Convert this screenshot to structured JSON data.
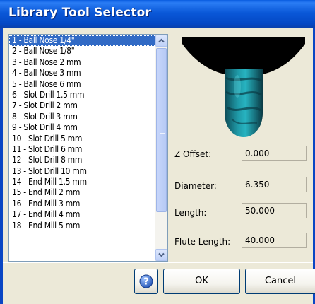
{
  "window": {
    "title": "Library Tool Selector",
    "accent_color": "#0a58d8"
  },
  "tool_list": {
    "selected_index": 0,
    "items": [
      "1 - Ball Nose 1/4\"",
      "2 - Ball Nose 1/8\"",
      "3 - Ball Nose 2 mm",
      "4 - Ball Nose 3 mm",
      "5 - Ball Nose 6 mm",
      "6 - Slot Drill 1.5 mm",
      "7 - Slot Drill 2 mm",
      "8 - Slot Drill 3 mm",
      "9 - Slot Drill 4 mm",
      "10 - Slot Drill 5 mm",
      "11 - Slot Drill 6 mm",
      "12 - Slot Drill 8 mm",
      "13 - Slot Drill 10 mm",
      "14 - End Mill 1.5 mm",
      "15 - End Mill 2 mm",
      "16 - End Mill 3 mm",
      "17 - End Mill 4 mm",
      "18 - End Mill 5 mm"
    ]
  },
  "preview": {
    "image": "ball-nose-tool-preview"
  },
  "fields": {
    "z_offset": {
      "label": "Z Offset:",
      "value": "0.000"
    },
    "diameter": {
      "label": "Diameter:",
      "value": "6.350"
    },
    "length": {
      "label": "Length:",
      "value": "50.000"
    },
    "flute_length": {
      "label": "Flute Length:",
      "value": "40.000"
    }
  },
  "buttons": {
    "help_icon": "help-icon",
    "ok": "OK",
    "cancel": "Cancel"
  }
}
